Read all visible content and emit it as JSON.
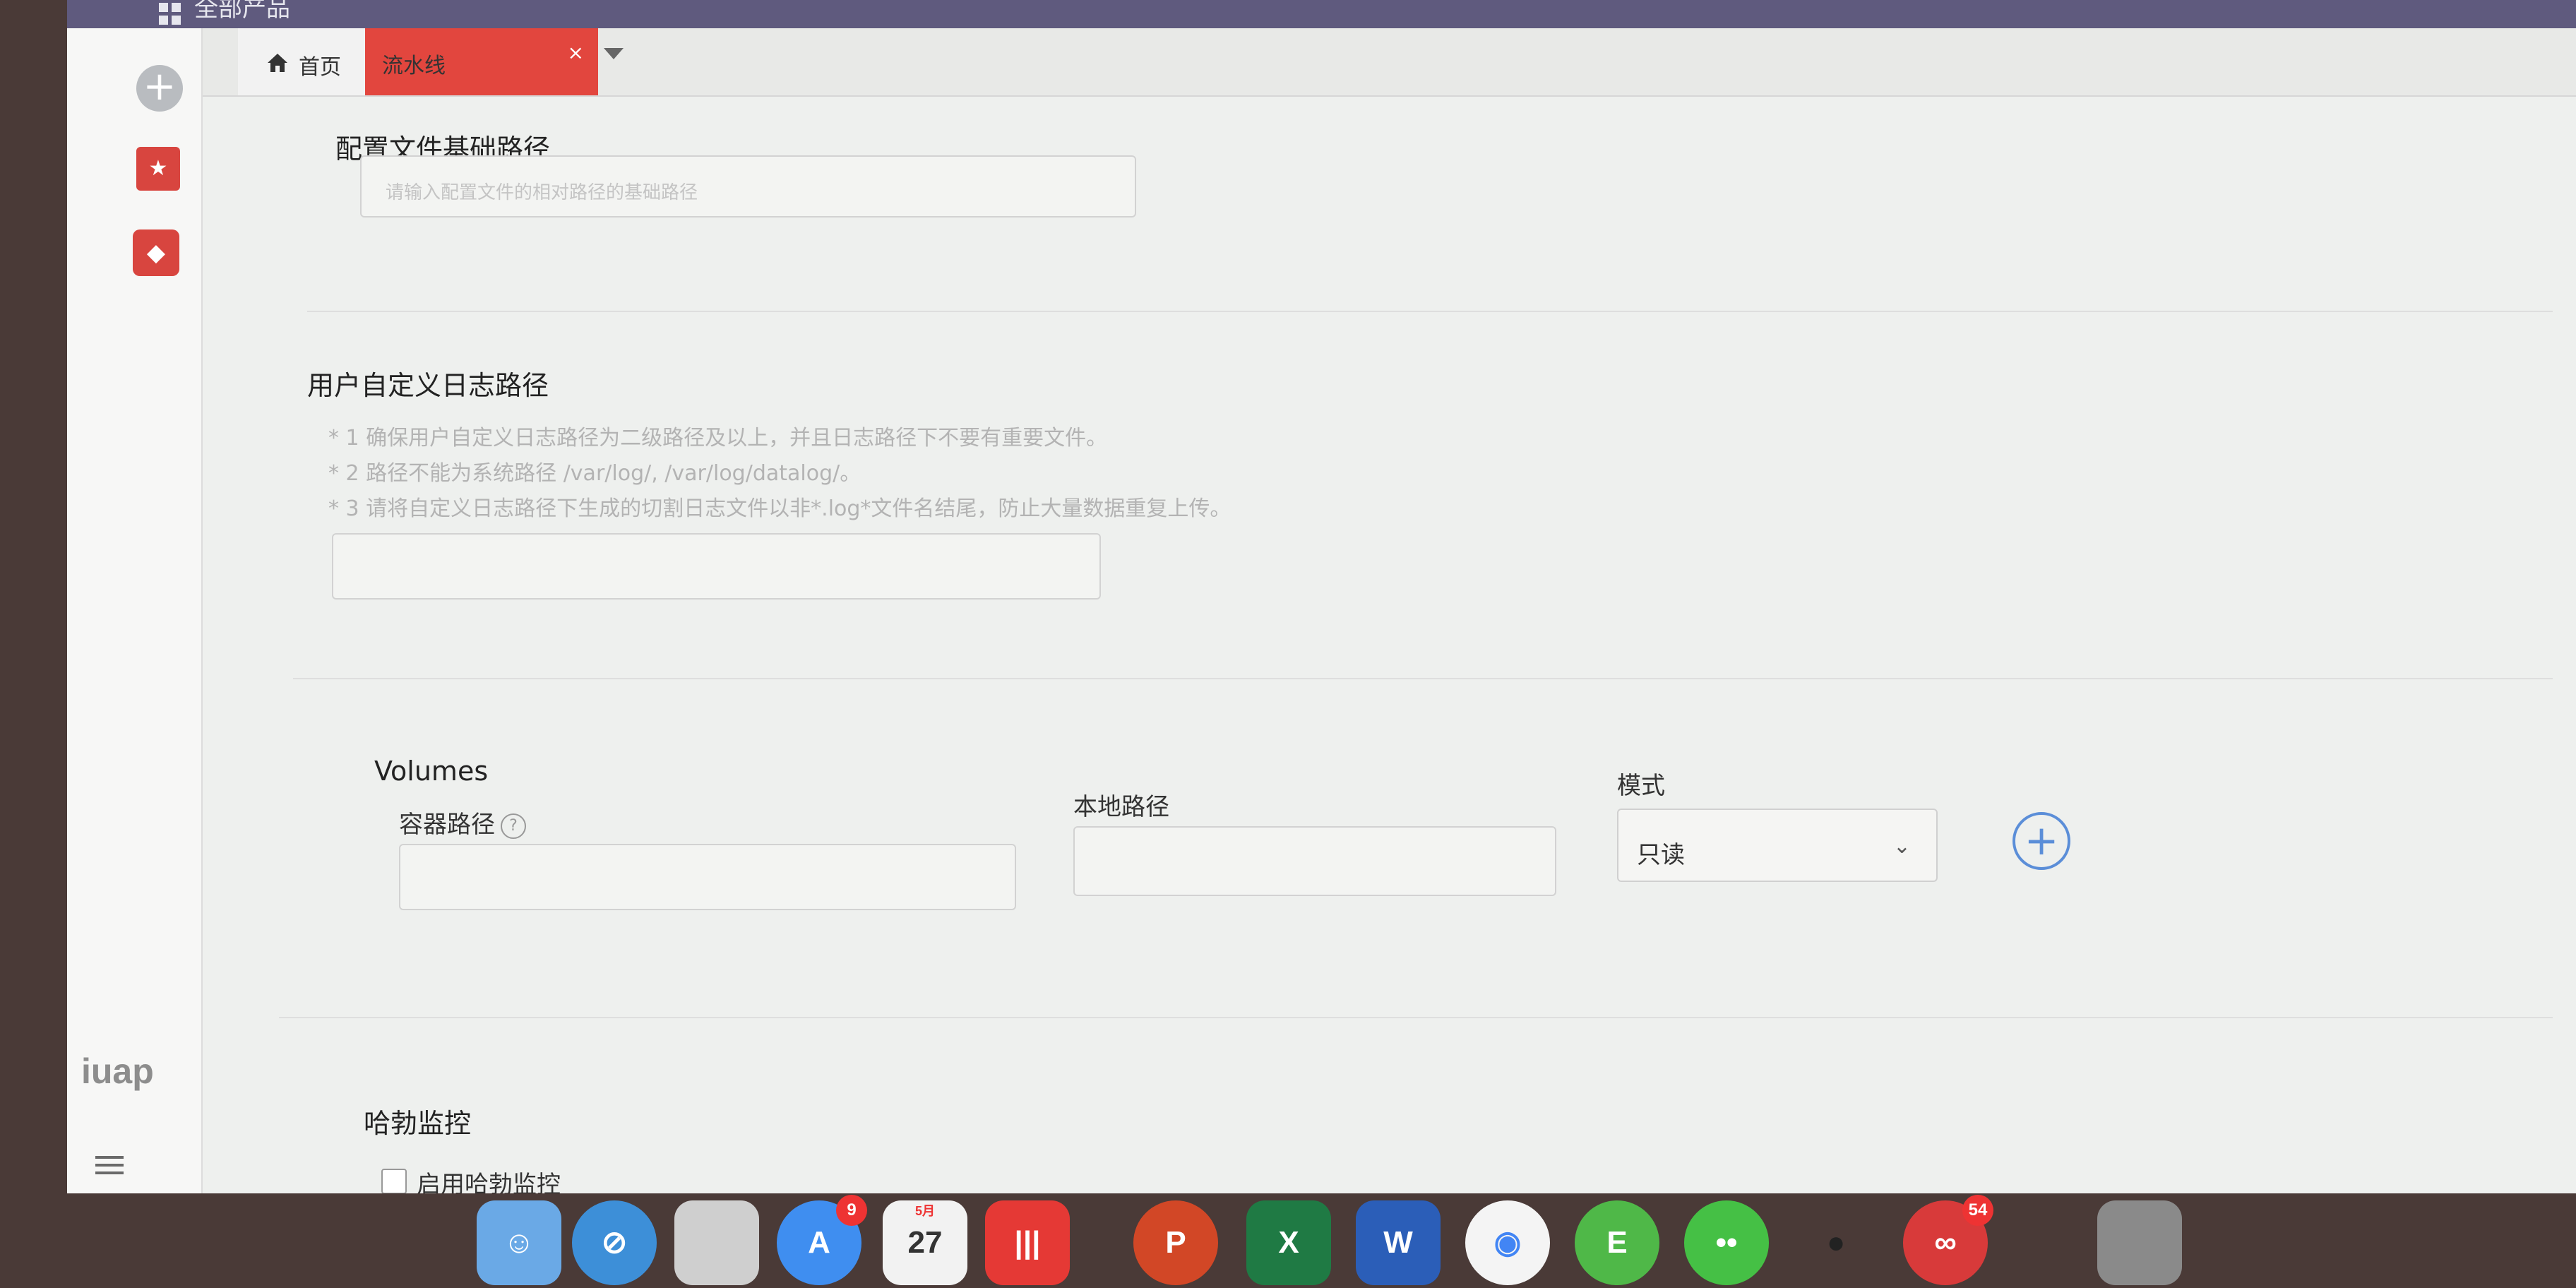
{
  "topbar": {
    "title": "全部产品"
  },
  "tabs": {
    "home": "首页",
    "active": "流水线",
    "close": "×"
  },
  "sidebar": {
    "logo": "iuap"
  },
  "config_path": {
    "title": "配置文件基础路径",
    "placeholder": "请输入配置文件的相对路径的基础路径"
  },
  "log_path": {
    "title": "用户自定义日志路径",
    "hints": [
      "* 1 确保用户自定义日志路径为二级路径及以上，并且日志路径下不要有重要文件。",
      "* 2 路径不能为系统路径 /var/log/, /var/log/datalog/。",
      "* 3 请将自定义日志路径下生成的切割日志文件以非*.log*文件名结尾，防止大量数据重复上传。"
    ]
  },
  "volumes": {
    "title": "Volumes",
    "container_path_label": "容器路径",
    "help_glyph": "?",
    "local_path_label": "本地路径",
    "mode_label": "模式",
    "mode_value": "只读",
    "add_glyph": "+"
  },
  "monitor": {
    "title": "哈勃监控",
    "enable_label": "启用哈勃监控"
  },
  "dock": {
    "calendar_day": "27",
    "calendar_month": "5月",
    "appstore_badge": "9",
    "app_badge": "54",
    "icons": [
      "finder-icon",
      "safari-icon",
      "preview-icon",
      "appstore-icon",
      "calendar-icon",
      "music-icon",
      "powerpoint-icon",
      "excel-icon",
      "word-icon",
      "chrome-icon",
      "evernote-icon",
      "wechat-icon",
      "qq-icon",
      "app-icon",
      "trash-icon"
    ]
  }
}
